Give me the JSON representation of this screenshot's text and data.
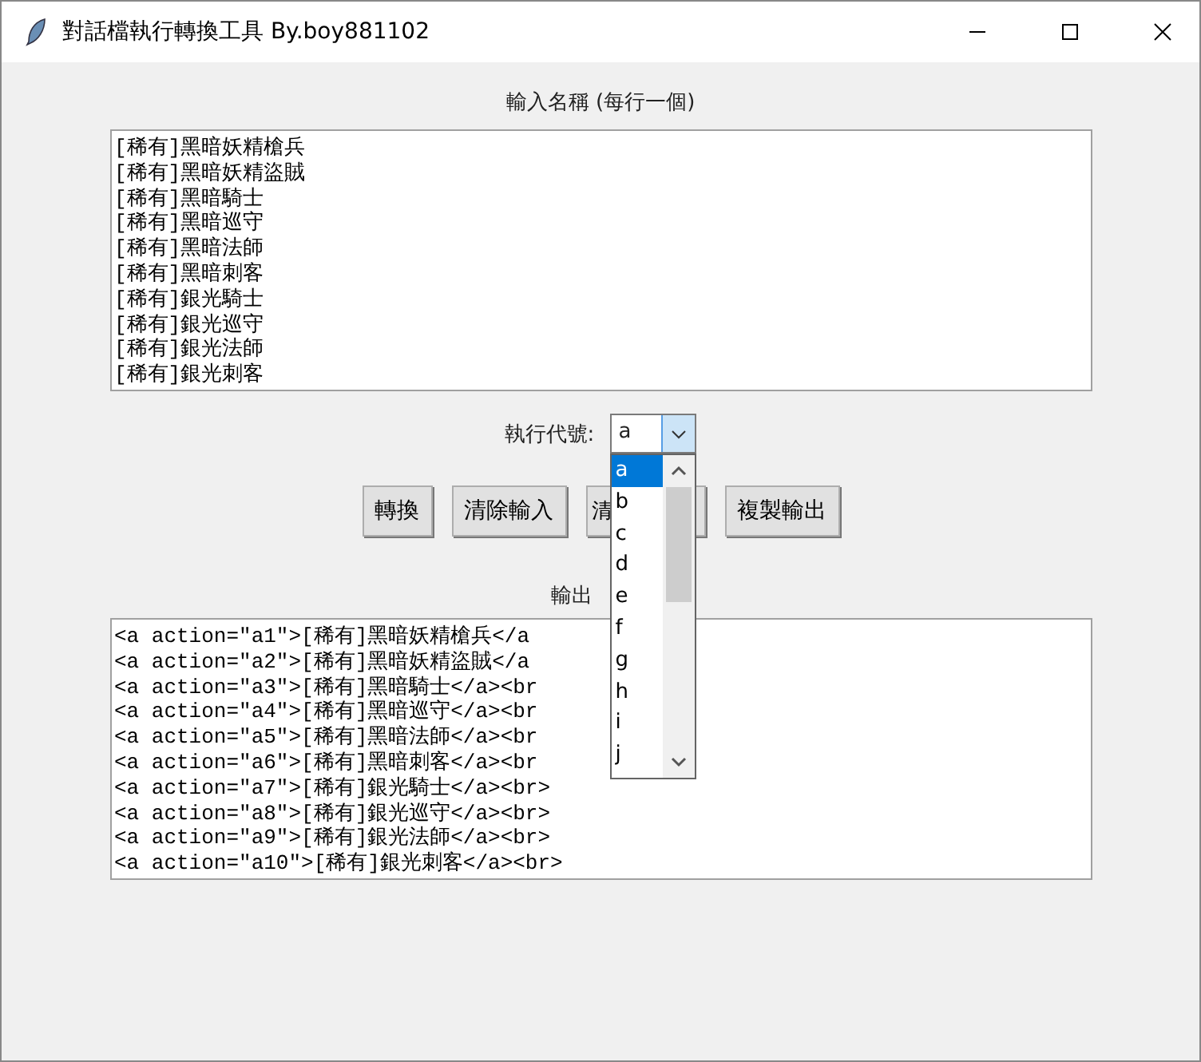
{
  "window": {
    "title": "對話檔執行轉換工具 By.boy881102"
  },
  "input": {
    "label": "輸入名稱 (每行一個)",
    "lines": [
      "[稀有]黑暗妖精槍兵",
      "[稀有]黑暗妖精盜賊",
      "[稀有]黑暗騎士",
      "[稀有]黑暗巡守",
      "[稀有]黑暗法師",
      "[稀有]黑暗刺客",
      "[稀有]銀光騎士",
      "[稀有]銀光巡守",
      "[稀有]銀光法師",
      "[稀有]銀光刺客"
    ]
  },
  "code": {
    "label": "執行代號:",
    "value": "a",
    "options": [
      {
        "label": "a",
        "selected": true
      },
      {
        "label": "b",
        "selected": false
      },
      {
        "label": "c",
        "selected": false
      },
      {
        "label": "d",
        "selected": false
      },
      {
        "label": "e",
        "selected": false
      },
      {
        "label": "f",
        "selected": false
      },
      {
        "label": "g",
        "selected": false
      },
      {
        "label": "h",
        "selected": false
      },
      {
        "label": "i",
        "selected": false
      },
      {
        "label": "j",
        "selected": false
      }
    ]
  },
  "buttons": [
    "轉換",
    "清除輸入",
    "清",
    "複製輸出"
  ],
  "output": {
    "label": "輸出",
    "lines": [
      "<a action=\"a1\">[稀有]黑暗妖精槍兵</a",
      "<a action=\"a2\">[稀有]黑暗妖精盜賊</a",
      "<a action=\"a3\">[稀有]黑暗騎士</a><br",
      "<a action=\"a4\">[稀有]黑暗巡守</a><br",
      "<a action=\"a5\">[稀有]黑暗法師</a><br",
      "<a action=\"a6\">[稀有]黑暗刺客</a><br",
      "<a action=\"a7\">[稀有]銀光騎士</a><br>",
      "<a action=\"a8\">[稀有]銀光巡守</a><br>",
      "<a action=\"a9\">[稀有]銀光法師</a><br>",
      "<a action=\"a10\">[稀有]銀光刺客</a><br>"
    ]
  }
}
